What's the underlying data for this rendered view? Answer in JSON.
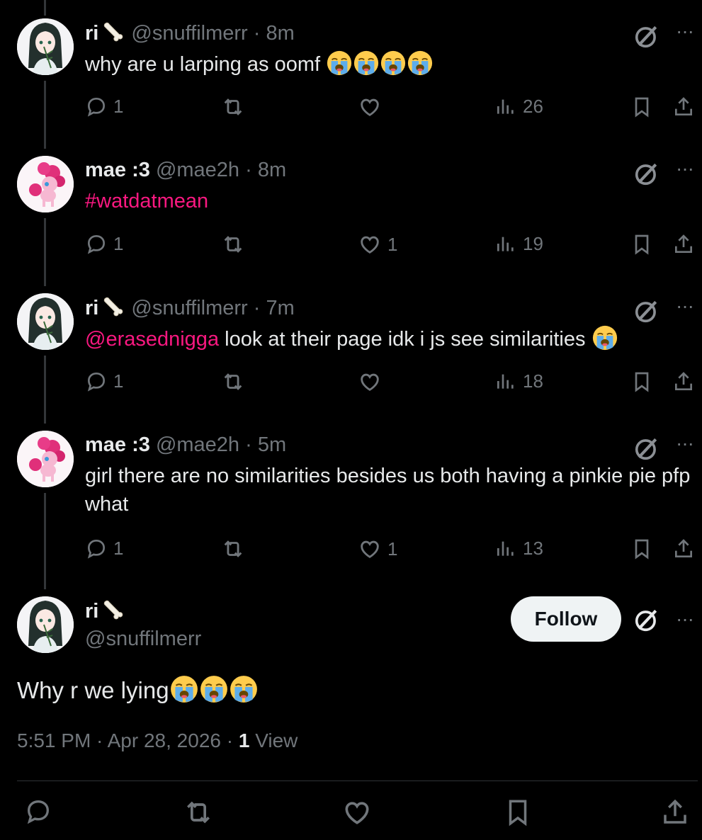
{
  "replies": [
    {
      "author": "ri",
      "handle": "@snuffilmerr",
      "time": "· 8m",
      "text": "why are u larping as oomf",
      "emoji_count": 4,
      "reply_count": "1",
      "like_count": "",
      "views": "26",
      "avatar": "girl-avatar"
    },
    {
      "author": "mae :3",
      "handle": "@mae2h",
      "time": "· 8m",
      "text": "#watdatmean",
      "reply_count": "1",
      "like_count": "1",
      "views": "19",
      "avatar": "pinkie-pie-avatar"
    },
    {
      "author": "ri",
      "handle": "@snuffilmerr",
      "time": "· 7m",
      "mention": "@erasednigga",
      "text": " look at their page idk i js see similarities",
      "emoji_count": 1,
      "reply_count": "1",
      "like_count": "",
      "views": "18",
      "avatar": "girl-avatar"
    },
    {
      "author": "mae :3",
      "handle": "@mae2h",
      "time": "· 5m",
      "text": "girl there are no similarities besides us both having a pinkie pie pfp what",
      "reply_count": "1",
      "like_count": "1",
      "views": "13",
      "avatar": "pinkie-pie-avatar"
    }
  ],
  "main_post": {
    "author": "ri",
    "handle": "@snuffilmerr",
    "follow_label": "Follow",
    "text": "Why r we lying",
    "emoji_count": 3,
    "time": "5:51 PM · Apr 28, 2026 · ",
    "views": "1",
    "views_label": " View"
  },
  "icons": {
    "reply": "reply-icon",
    "repost": "repost-icon",
    "like": "heart-icon",
    "views": "views-chart-icon",
    "bookmark": "bookmark-icon",
    "share": "share-icon",
    "grok": "grok-icon",
    "more": "more-icon",
    "emoji": "loudly-crying-face-emoji",
    "bone": "bone-emoji"
  },
  "colors": {
    "background": "#000000",
    "text": "#e7e9ea",
    "muted": "#71767b",
    "link": "#f91880",
    "follow_bg": "#eff3f4"
  }
}
